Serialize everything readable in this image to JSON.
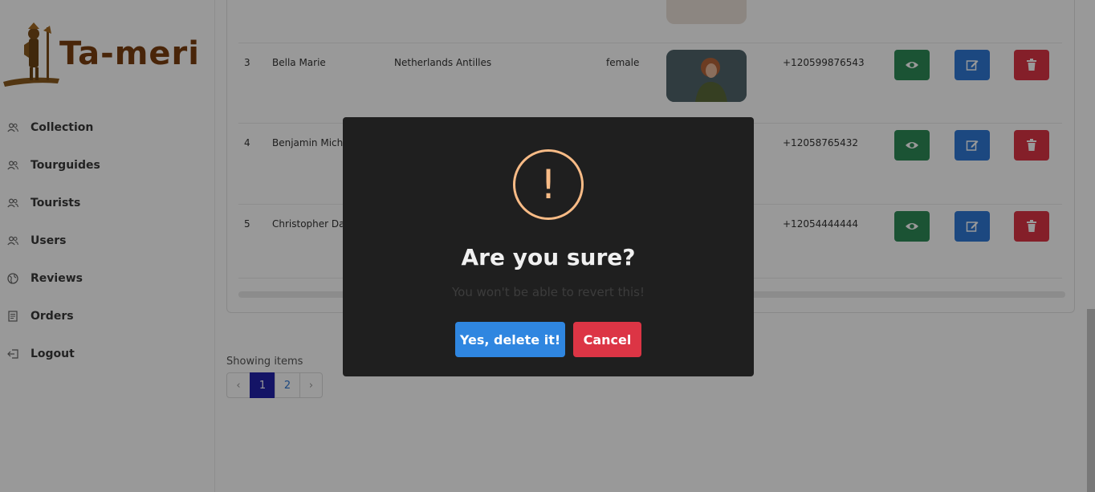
{
  "brand": {
    "name": "Ta-meri"
  },
  "sidebar": {
    "items": [
      {
        "label": "Collection",
        "icon": "users-icon"
      },
      {
        "label": "Tourguides",
        "icon": "users-icon"
      },
      {
        "label": "Tourists",
        "icon": "users-icon"
      },
      {
        "label": "Users",
        "icon": "users-icon"
      },
      {
        "label": "Reviews",
        "icon": "globe-icon"
      },
      {
        "label": "Orders",
        "icon": "receipt-icon"
      },
      {
        "label": "Logout",
        "icon": "logout-icon"
      }
    ]
  },
  "table": {
    "rows": [
      {
        "num": "3",
        "name": "Bella Marie",
        "country": "Netherlands Antilles",
        "gender": "female",
        "phone": "+120599876543"
      },
      {
        "num": "4",
        "name": "Benjamin Micha",
        "country": "",
        "gender": "",
        "phone": "+12058765432"
      },
      {
        "num": "5",
        "name": "Christopher Da",
        "country": "",
        "gender": "",
        "phone": "+12054444444"
      }
    ]
  },
  "pagination": {
    "showing": "Showing items",
    "prev": "‹",
    "next": "›",
    "pages": [
      "1",
      "2"
    ],
    "active": "1"
  },
  "dialog": {
    "icon": "!",
    "title": "Are you sure?",
    "text": "You won't be able to revert this!",
    "confirm": "Yes, delete it!",
    "cancel": "Cancel"
  },
  "colors": {
    "view": "#2e8b57",
    "edit": "#2f78d6",
    "delete": "#dc3545",
    "confirm": "#2f86e0",
    "warning": "#f8bb86",
    "active_page": "#2222aa"
  }
}
